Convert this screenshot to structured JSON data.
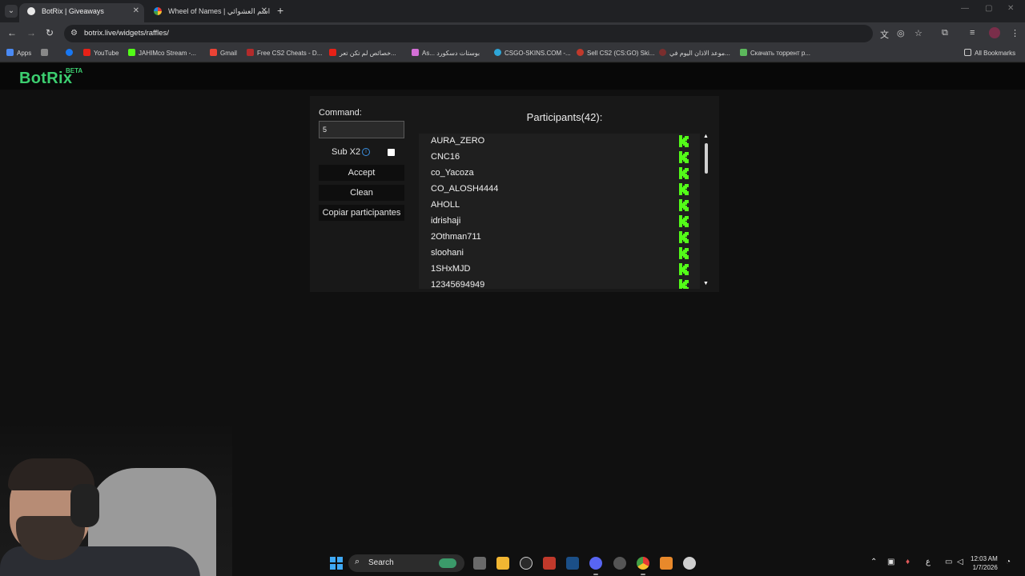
{
  "browser": {
    "tabs": [
      {
        "label": "BotRix | Giveaways",
        "active": true
      },
      {
        "label": "Wheel of Names | اسم العشوائي",
        "active": false
      }
    ],
    "url": "botrix.live/widgets/raffles/",
    "bookmarks": [
      "Apps",
      "YouTube",
      "JAHIMco Stream -...",
      "Gmail",
      "Free CS2 Cheats - D...",
      "خصائص لم تكن تعر...",
      "As... بوستات دسكورد",
      "CSGO-SKINS.COM -...",
      "Sell CS2 (CS:GO) Ski...",
      "موعد الاذان اليوم في...",
      "Скачать торрент р...",
      "All Bookmarks"
    ]
  },
  "app": {
    "logo": "BotRix",
    "badge": "BETA"
  },
  "form": {
    "command_label": "Command:",
    "command_value": "5",
    "sub_label": "Sub X2",
    "sub_checked": false,
    "accept_label": "Accept",
    "clean_label": "Clean",
    "copy_label": "Copiar participantes"
  },
  "participants": {
    "title": "Participants(42):",
    "items": [
      "AURA_ZERO",
      "CNC16",
      "co_Yacoza",
      "CO_ALOSH4444",
      "AHOLL",
      "idrishaji",
      "2Othman711",
      "sloohani",
      "1SHxMJD",
      "12345694949"
    ]
  },
  "taskbar": {
    "search_label": "Search",
    "lang": "ع",
    "time": "12:03 AM",
    "date": "1/7/2026"
  },
  "colors": {
    "brand": "#3ccf70",
    "kick": "#53fc18",
    "info": "#3a8fe0"
  }
}
